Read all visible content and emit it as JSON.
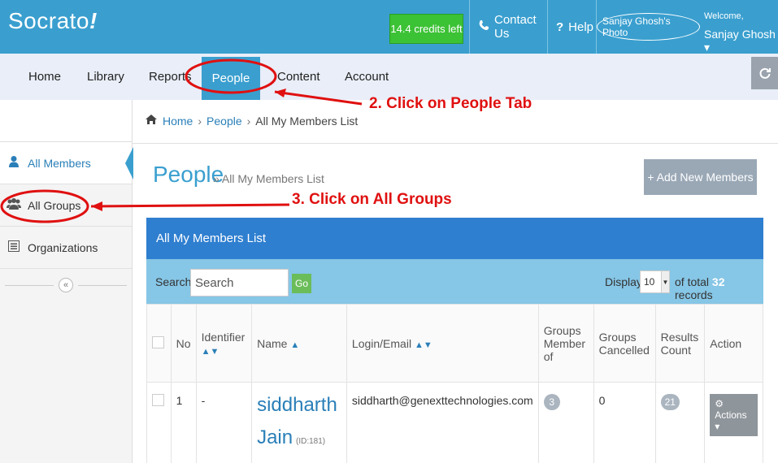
{
  "topbar": {
    "logo": "Socrato",
    "logo_mark": "!",
    "credits": "14.4 credits left",
    "contact_label": "Contact Us",
    "contact_icon": "phone-icon",
    "help_label": "Help",
    "help_icon": "question-icon",
    "user_photo": "Sanjay Ghosh's Photo",
    "welcome": "Welcome,",
    "username": "Sanjay Ghosh ▾"
  },
  "nav": {
    "items": [
      "Home",
      "Library",
      "Reports",
      "People",
      "Content",
      "Account"
    ],
    "active": "People",
    "refresh_icon": "refresh-icon"
  },
  "sidebar": {
    "items": [
      {
        "label": "All Members",
        "icon": "user-icon"
      },
      {
        "label": "All Groups",
        "icon": "group-icon"
      },
      {
        "label": "Organizations",
        "icon": "list-icon"
      }
    ],
    "collapse_glyph": "«"
  },
  "breadcrumb": {
    "home": "Home",
    "sep": "›",
    "people": "People",
    "current": "All My Members List"
  },
  "page": {
    "title": "People",
    "subtitle": "» All My Members List",
    "add_button": "+ Add New Members"
  },
  "panel": {
    "title": "All My Members List",
    "search_label": "Search:",
    "search_placeholder": "Search",
    "go_label": "Go",
    "display_label": "Display",
    "display_value": "10",
    "total_prefix": "of total",
    "total_count": "32",
    "total_suffix": "records"
  },
  "table": {
    "headers": {
      "no": "No",
      "identifier": "Identifier",
      "name": "Name",
      "login": "Login/Email",
      "groups_member": "Groups Member of",
      "groups_cancelled": "Groups Cancelled",
      "results": "Results Count",
      "action": "Action"
    },
    "rows": [
      {
        "no": "1",
        "identifier": "-",
        "name": "siddharth Jain",
        "id": "(ID:181)",
        "email": "siddharth@genexttechnologies.com",
        "groups_member": "3",
        "groups_cancelled": "0",
        "results": "21",
        "action": "Actions ▾"
      }
    ]
  },
  "annotations": {
    "step2": "2. Click on People Tab",
    "step3": "3. Click on All Groups",
    "color": "#e01010"
  }
}
